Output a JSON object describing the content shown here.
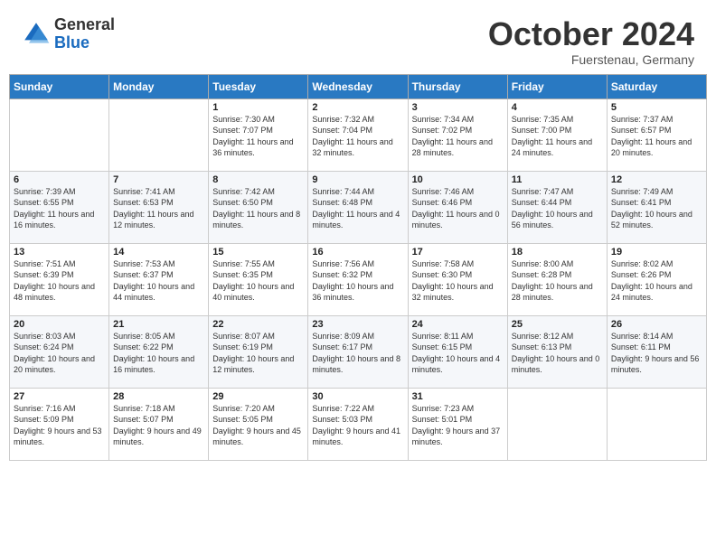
{
  "header": {
    "logo_general": "General",
    "logo_blue": "Blue",
    "month_title": "October 2024",
    "subtitle": "Fuerstenau, Germany"
  },
  "weekdays": [
    "Sunday",
    "Monday",
    "Tuesday",
    "Wednesday",
    "Thursday",
    "Friday",
    "Saturday"
  ],
  "weeks": [
    [
      {
        "day": "",
        "sunrise": "",
        "sunset": "",
        "daylight": ""
      },
      {
        "day": "",
        "sunrise": "",
        "sunset": "",
        "daylight": ""
      },
      {
        "day": "1",
        "sunrise": "Sunrise: 7:30 AM",
        "sunset": "Sunset: 7:07 PM",
        "daylight": "Daylight: 11 hours and 36 minutes."
      },
      {
        "day": "2",
        "sunrise": "Sunrise: 7:32 AM",
        "sunset": "Sunset: 7:04 PM",
        "daylight": "Daylight: 11 hours and 32 minutes."
      },
      {
        "day": "3",
        "sunrise": "Sunrise: 7:34 AM",
        "sunset": "Sunset: 7:02 PM",
        "daylight": "Daylight: 11 hours and 28 minutes."
      },
      {
        "day": "4",
        "sunrise": "Sunrise: 7:35 AM",
        "sunset": "Sunset: 7:00 PM",
        "daylight": "Daylight: 11 hours and 24 minutes."
      },
      {
        "day": "5",
        "sunrise": "Sunrise: 7:37 AM",
        "sunset": "Sunset: 6:57 PM",
        "daylight": "Daylight: 11 hours and 20 minutes."
      }
    ],
    [
      {
        "day": "6",
        "sunrise": "Sunrise: 7:39 AM",
        "sunset": "Sunset: 6:55 PM",
        "daylight": "Daylight: 11 hours and 16 minutes."
      },
      {
        "day": "7",
        "sunrise": "Sunrise: 7:41 AM",
        "sunset": "Sunset: 6:53 PM",
        "daylight": "Daylight: 11 hours and 12 minutes."
      },
      {
        "day": "8",
        "sunrise": "Sunrise: 7:42 AM",
        "sunset": "Sunset: 6:50 PM",
        "daylight": "Daylight: 11 hours and 8 minutes."
      },
      {
        "day": "9",
        "sunrise": "Sunrise: 7:44 AM",
        "sunset": "Sunset: 6:48 PM",
        "daylight": "Daylight: 11 hours and 4 minutes."
      },
      {
        "day": "10",
        "sunrise": "Sunrise: 7:46 AM",
        "sunset": "Sunset: 6:46 PM",
        "daylight": "Daylight: 11 hours and 0 minutes."
      },
      {
        "day": "11",
        "sunrise": "Sunrise: 7:47 AM",
        "sunset": "Sunset: 6:44 PM",
        "daylight": "Daylight: 10 hours and 56 minutes."
      },
      {
        "day": "12",
        "sunrise": "Sunrise: 7:49 AM",
        "sunset": "Sunset: 6:41 PM",
        "daylight": "Daylight: 10 hours and 52 minutes."
      }
    ],
    [
      {
        "day": "13",
        "sunrise": "Sunrise: 7:51 AM",
        "sunset": "Sunset: 6:39 PM",
        "daylight": "Daylight: 10 hours and 48 minutes."
      },
      {
        "day": "14",
        "sunrise": "Sunrise: 7:53 AM",
        "sunset": "Sunset: 6:37 PM",
        "daylight": "Daylight: 10 hours and 44 minutes."
      },
      {
        "day": "15",
        "sunrise": "Sunrise: 7:55 AM",
        "sunset": "Sunset: 6:35 PM",
        "daylight": "Daylight: 10 hours and 40 minutes."
      },
      {
        "day": "16",
        "sunrise": "Sunrise: 7:56 AM",
        "sunset": "Sunset: 6:32 PM",
        "daylight": "Daylight: 10 hours and 36 minutes."
      },
      {
        "day": "17",
        "sunrise": "Sunrise: 7:58 AM",
        "sunset": "Sunset: 6:30 PM",
        "daylight": "Daylight: 10 hours and 32 minutes."
      },
      {
        "day": "18",
        "sunrise": "Sunrise: 8:00 AM",
        "sunset": "Sunset: 6:28 PM",
        "daylight": "Daylight: 10 hours and 28 minutes."
      },
      {
        "day": "19",
        "sunrise": "Sunrise: 8:02 AM",
        "sunset": "Sunset: 6:26 PM",
        "daylight": "Daylight: 10 hours and 24 minutes."
      }
    ],
    [
      {
        "day": "20",
        "sunrise": "Sunrise: 8:03 AM",
        "sunset": "Sunset: 6:24 PM",
        "daylight": "Daylight: 10 hours and 20 minutes."
      },
      {
        "day": "21",
        "sunrise": "Sunrise: 8:05 AM",
        "sunset": "Sunset: 6:22 PM",
        "daylight": "Daylight: 10 hours and 16 minutes."
      },
      {
        "day": "22",
        "sunrise": "Sunrise: 8:07 AM",
        "sunset": "Sunset: 6:19 PM",
        "daylight": "Daylight: 10 hours and 12 minutes."
      },
      {
        "day": "23",
        "sunrise": "Sunrise: 8:09 AM",
        "sunset": "Sunset: 6:17 PM",
        "daylight": "Daylight: 10 hours and 8 minutes."
      },
      {
        "day": "24",
        "sunrise": "Sunrise: 8:11 AM",
        "sunset": "Sunset: 6:15 PM",
        "daylight": "Daylight: 10 hours and 4 minutes."
      },
      {
        "day": "25",
        "sunrise": "Sunrise: 8:12 AM",
        "sunset": "Sunset: 6:13 PM",
        "daylight": "Daylight: 10 hours and 0 minutes."
      },
      {
        "day": "26",
        "sunrise": "Sunrise: 8:14 AM",
        "sunset": "Sunset: 6:11 PM",
        "daylight": "Daylight: 9 hours and 56 minutes."
      }
    ],
    [
      {
        "day": "27",
        "sunrise": "Sunrise: 7:16 AM",
        "sunset": "Sunset: 5:09 PM",
        "daylight": "Daylight: 9 hours and 53 minutes."
      },
      {
        "day": "28",
        "sunrise": "Sunrise: 7:18 AM",
        "sunset": "Sunset: 5:07 PM",
        "daylight": "Daylight: 9 hours and 49 minutes."
      },
      {
        "day": "29",
        "sunrise": "Sunrise: 7:20 AM",
        "sunset": "Sunset: 5:05 PM",
        "daylight": "Daylight: 9 hours and 45 minutes."
      },
      {
        "day": "30",
        "sunrise": "Sunrise: 7:22 AM",
        "sunset": "Sunset: 5:03 PM",
        "daylight": "Daylight: 9 hours and 41 minutes."
      },
      {
        "day": "31",
        "sunrise": "Sunrise: 7:23 AM",
        "sunset": "Sunset: 5:01 PM",
        "daylight": "Daylight: 9 hours and 37 minutes."
      },
      {
        "day": "",
        "sunrise": "",
        "sunset": "",
        "daylight": ""
      },
      {
        "day": "",
        "sunrise": "",
        "sunset": "",
        "daylight": ""
      }
    ]
  ]
}
